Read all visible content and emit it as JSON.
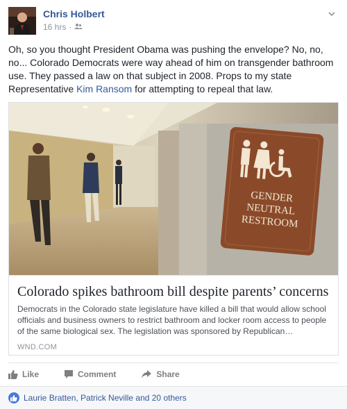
{
  "post": {
    "author": "Chris Holbert",
    "time": "16 hrs",
    "privacy_icon": "friends-icon",
    "text_before_link": "Oh, so you thought President Obama was pushing the envelope? No, no, no... Colorado Democrats were way ahead of him on transgender bathroom use. They passed a law on that subject in 2008. Props to my state Representative ",
    "link_text": "Kim Ransom",
    "text_after_link": " for attempting to repeal that law."
  },
  "card": {
    "title": "Colorado spikes bathroom bill despite parents’ concerns",
    "description": "Democrats in the Colorado state legislature have killed a bill that would allow school officials and business owners to restrict bathroom and locker room access to people of the same biological sex. The legislation was sponsored by Republican…",
    "source": "WND.COM",
    "sign": {
      "line1": "GENDER",
      "line2": "NEUTRAL",
      "line3": "RESTROOM"
    }
  },
  "actions": {
    "like": "Like",
    "comment": "Comment",
    "share": "Share"
  },
  "reactions": {
    "text": "Laurie Bratten, Patrick Neville and 20 others"
  },
  "colors": {
    "link": "#365899",
    "sign_brown": "#8a4a2a",
    "like_blue": "#4b79d8"
  }
}
